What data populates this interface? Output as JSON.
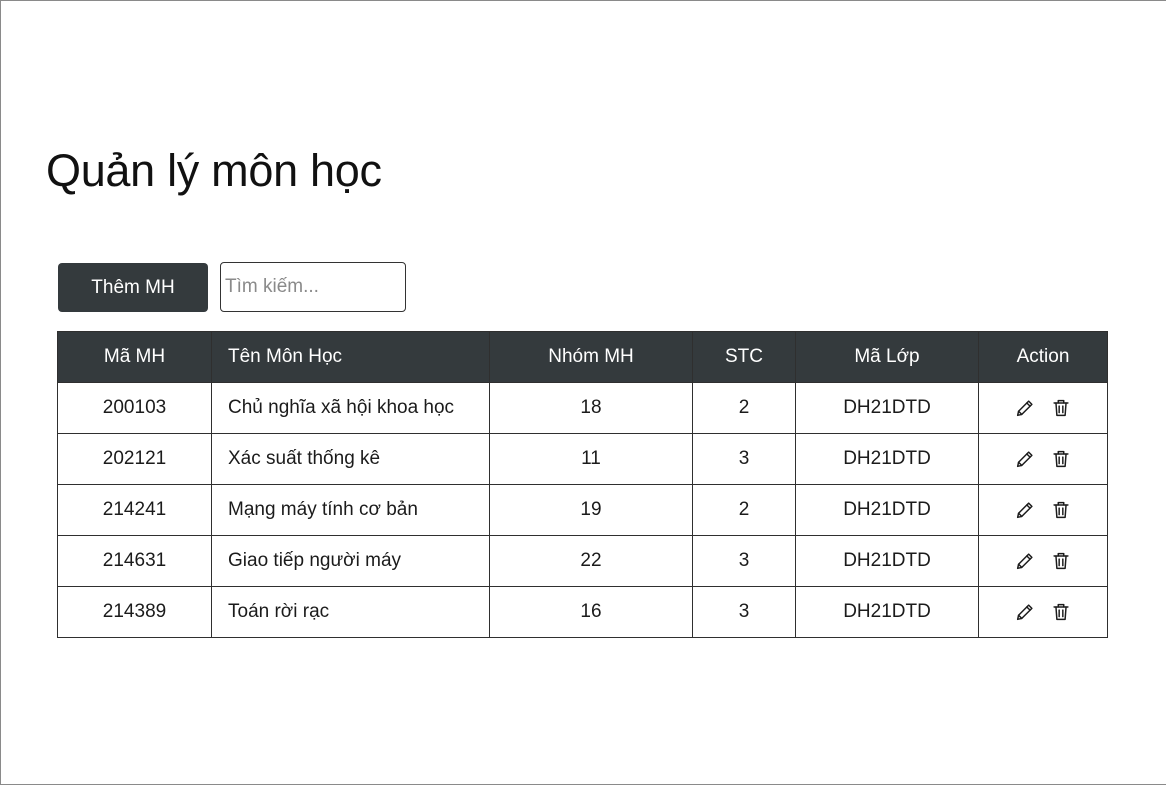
{
  "page": {
    "title": "Quản lý môn học"
  },
  "toolbar": {
    "add_label": "Thêm MH",
    "search_placeholder": "Tìm kiếm..."
  },
  "table": {
    "headers": {
      "code": "Mã MH",
      "name": "Tên Môn Học",
      "group": "Nhóm MH",
      "credits": "STC",
      "class_code": "Mã Lớp",
      "action": "Action"
    },
    "rows": [
      {
        "code": "200103",
        "name": "Chủ nghĩa xã hội khoa học",
        "group": "18",
        "credits": "2",
        "class_code": "DH21DTD"
      },
      {
        "code": "202121",
        "name": "Xác suất thống kê",
        "group": "11",
        "credits": "3",
        "class_code": "DH21DTD"
      },
      {
        "code": "214241",
        "name": "Mạng máy tính cơ bản",
        "group": "19",
        "credits": "2",
        "class_code": "DH21DTD"
      },
      {
        "code": "214631",
        "name": "Giao tiếp người máy",
        "group": "22",
        "credits": "3",
        "class_code": "DH21DTD"
      },
      {
        "code": "214389",
        "name": "Toán rời rạc",
        "group": "16",
        "credits": "3",
        "class_code": "DH21DTD"
      }
    ],
    "row_actions": [
      "pencil-icon",
      "trash-icon"
    ]
  },
  "colors": {
    "header_bg": "#343a3d",
    "header_text": "#ffffff",
    "border": "#2f2f2f"
  }
}
